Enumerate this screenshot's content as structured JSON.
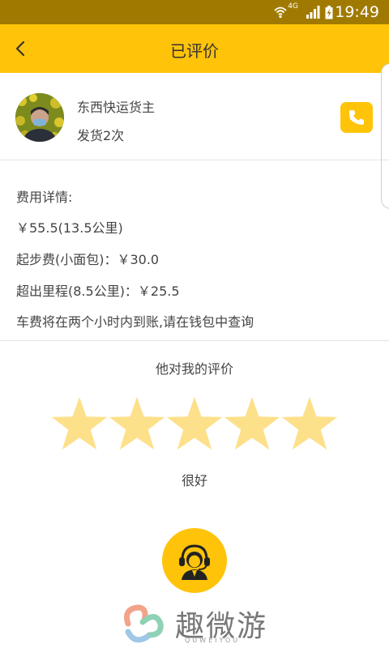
{
  "status_bar": {
    "network": "4G",
    "time": "19:49",
    "icons": [
      "wifi-icon",
      "signal-icon",
      "battery-charging-icon"
    ]
  },
  "header": {
    "title": "已评价",
    "back_icon": "back-arrow-icon"
  },
  "profile": {
    "name": "东西快运货主",
    "shipment_count": "发货2次",
    "phone_icon": "phone-icon"
  },
  "fees": {
    "heading": "费用详情:",
    "total": "￥55.5(13.5公里)",
    "base_fare": "起步费(小面包)：￥30.0",
    "extra_distance": "超出里程(8.5公里)：￥25.5",
    "note": "车费将在两个小时内到账,请在钱包中查询"
  },
  "rating": {
    "title": "他对我的评价",
    "stars": 5,
    "max_stars": 5,
    "star_color": "#fde08a",
    "comment": "很好"
  },
  "customer_service": {
    "icon": "customer-service-icon"
  },
  "watermark": {
    "text": "趣微游",
    "sub": "QUWEIYOU"
  },
  "colors": {
    "accent": "#ffc30a",
    "status_bar": "#a07a00"
  }
}
